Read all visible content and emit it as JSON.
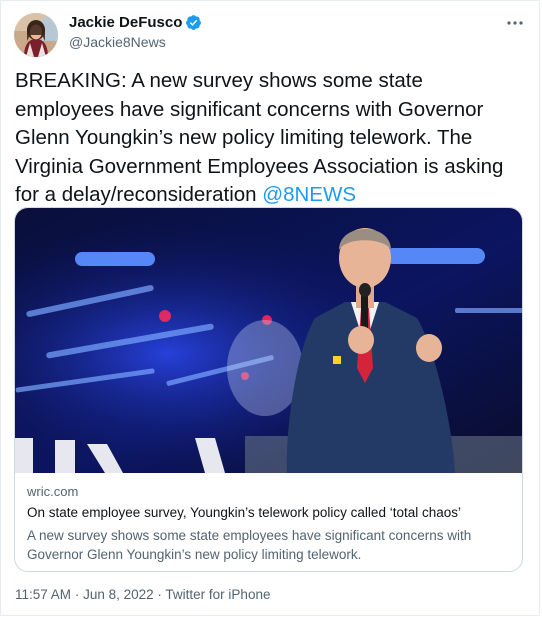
{
  "author": {
    "display_name": "Jackie DeFusco",
    "handle": "@Jackie8News"
  },
  "tweet": {
    "text_main": "BREAKING:  A new survey shows some state employees have significant concerns with Governor Glenn Youngkin’s new policy limiting telework. The Virginia Government Employees Association is asking for a delay/reconsideration ",
    "mention": "@8NEWS"
  },
  "card": {
    "domain": "wric.com",
    "title": "On state employee survey, Youngkin’s telework policy called ‘total chaos’",
    "description": "A new survey shows some state employees have significant concerns with Governor Glenn Youngkin’s new policy limiting telework."
  },
  "meta": {
    "time": "11:57 AM",
    "separator": "·",
    "date": "Jun 8, 2022",
    "source": "Twitter for iPhone"
  },
  "colors": {
    "accent": "#1d9bf0",
    "text": "#0f1419",
    "secondary": "#536471"
  }
}
